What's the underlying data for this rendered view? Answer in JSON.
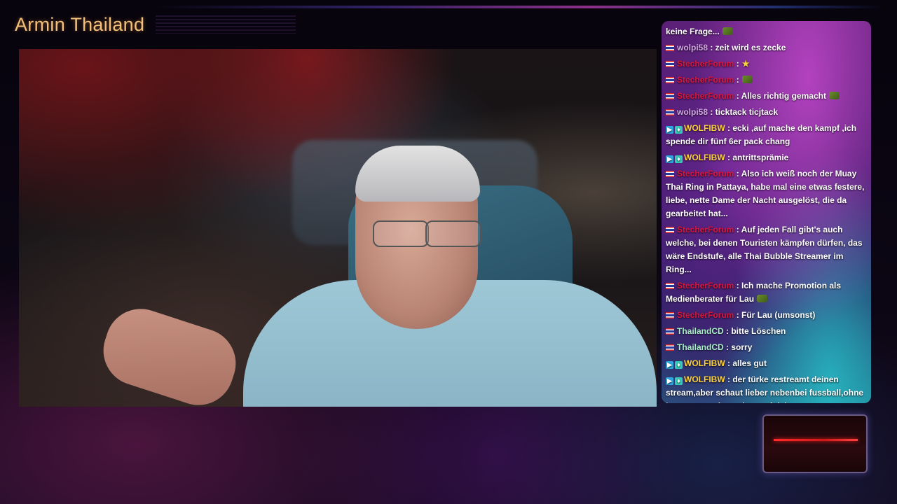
{
  "stream": {
    "title": "Armin Thailand"
  },
  "colors": {
    "title": "#f3c07a",
    "user_pink": "#d5a7e6",
    "user_red": "#e0153a",
    "user_yellow": "#ffd23b",
    "user_green": "#a8f0c8"
  },
  "chat": {
    "messages": [
      {
        "user": "",
        "text": "keine Frage...",
        "user_color": "",
        "badges": [],
        "emote": true
      },
      {
        "user": "wolpi58",
        "text": ": zeit wird es zecke",
        "user_color": "#d5a7e6",
        "badges": [
          "flag"
        ],
        "emote": false
      },
      {
        "user": "StecherForum",
        "text": ":",
        "user_color": "#e0153a",
        "badges": [
          "flag"
        ],
        "emote": false,
        "star": "★"
      },
      {
        "user": "StecherForum",
        "text": ":",
        "user_color": "#e0153a",
        "badges": [
          "flag"
        ],
        "emote": true
      },
      {
        "user": "StecherForum",
        "text": ": Alles richtig gemacht",
        "user_color": "#e0153a",
        "badges": [
          "flag"
        ],
        "emote": true
      },
      {
        "user": "wolpi58",
        "text": ": ticktack ticjtack",
        "user_color": "#d5a7e6",
        "badges": [
          "flag"
        ],
        "emote": false
      },
      {
        "user": "WOLFIBW",
        "text": ": ecki ,auf mache den kampf ,ich spende dir fünf 6er pack chang",
        "user_color": "#ffd23b",
        "badges": [
          "sub",
          "gift"
        ],
        "emote": false
      },
      {
        "user": "WOLFIBW",
        "text": ": antrittsprämie",
        "user_color": "#ffd23b",
        "badges": [
          "sub",
          "gift"
        ],
        "emote": false
      },
      {
        "user": "StecherForum",
        "text": ": Also ich weiß noch der Muay Thai Ring in Pattaya, habe mal eine etwas festere, liebe, nette Dame der Nacht ausgelöst, die da gearbeitet hat...",
        "user_color": "#e0153a",
        "badges": [
          "flag"
        ],
        "emote": false
      },
      {
        "user": "StecherForum",
        "text": ": Auf jeden Fall gibt's auch welche, bei denen Touristen kämpfen dürfen, das wäre Endstufe, alle Thai Bubble Streamer im Ring...",
        "user_color": "#e0153a",
        "badges": [
          "flag"
        ],
        "emote": false
      },
      {
        "user": "StecherForum",
        "text": ": Ich mache Promotion als Medienberater für Lau",
        "user_color": "#e0153a",
        "badges": [
          "flag"
        ],
        "emote": true
      },
      {
        "user": "StecherForum",
        "text": ": Für Lau (umsonst)",
        "user_color": "#e0153a",
        "badges": [
          "flag"
        ],
        "emote": false
      },
      {
        "user": "ThailandCD",
        "text": ": bitte Löschen",
        "user_color": "#a8f0c8",
        "badges": [
          "flag"
        ],
        "emote": false
      },
      {
        "user": "ThailandCD",
        "text": ": sorry",
        "user_color": "#a8f0c8",
        "badges": [
          "flag"
        ],
        "emote": false
      },
      {
        "user": "WOLFIBW",
        "text": ": alles gut",
        "user_color": "#ffd23b",
        "badges": [
          "sub",
          "gift"
        ],
        "emote": false
      },
      {
        "user": "WOLFIBW",
        "text": ": der türke restreamt deinen stream,aber schaut lieber nebenbei fussball,ohne kommentar abzugeben auf deinen stream",
        "user_color": "#ffd23b",
        "badges": [
          "sub",
          "gift"
        ],
        "emote": false
      }
    ]
  }
}
